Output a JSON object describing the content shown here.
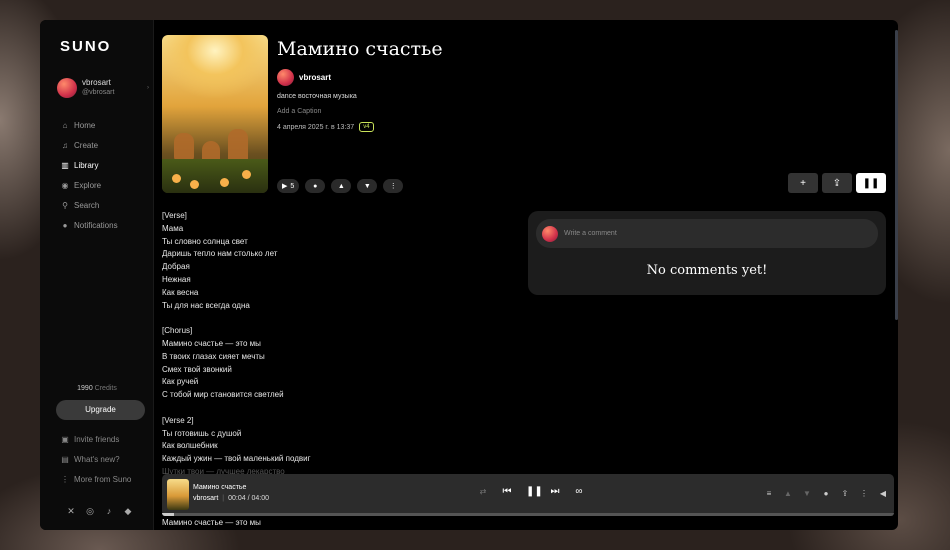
{
  "app": {
    "logo": "SUNO"
  },
  "user": {
    "name": "vbrosart",
    "handle": "@vbrosart"
  },
  "nav": [
    {
      "label": "Home",
      "icon": "home-icon",
      "active": false
    },
    {
      "label": "Create",
      "icon": "music-note-icon",
      "active": false
    },
    {
      "label": "Library",
      "icon": "library-icon",
      "active": true
    },
    {
      "label": "Explore",
      "icon": "compass-icon",
      "active": false
    },
    {
      "label": "Search",
      "icon": "search-icon",
      "active": false
    },
    {
      "label": "Notifications",
      "icon": "bell-icon",
      "active": false
    }
  ],
  "credits": {
    "amount": "1990",
    "label": "Credits"
  },
  "upgrade_label": "Upgrade",
  "bottom_nav": [
    {
      "label": "Invite friends",
      "icon": "gift-icon"
    },
    {
      "label": "What's new?",
      "icon": "news-icon"
    },
    {
      "label": "More from Suno",
      "icon": "more-vertical-icon"
    }
  ],
  "socials": [
    "x-icon",
    "instagram-icon",
    "tiktok-icon",
    "discord-icon"
  ],
  "song": {
    "title": "Мамино счастье",
    "artist": "vbrosart",
    "tags": "dance восточная музыка",
    "caption_placeholder": "Add a Caption",
    "date": "4 апреля 2025 г. в 13:37",
    "version": "v4",
    "play_count": "5"
  },
  "lyrics": [
    "[Verse]",
    "Мама",
    "Ты словно солнца свет",
    "Даришь тепло нам столько лет",
    "Добрая",
    "Нежная",
    "Как весна",
    "Ты для нас всегда одна",
    "",
    "[Chorus]",
    "Мамино счастье — это мы",
    "В твоих глазах сияет мечты",
    "Смех твой звонкий",
    "Как ручей",
    "С тобой мир становится светлей",
    "",
    "[Verse 2]",
    "Ты готовишь с душой",
    "Как волшебник",
    "Каждый ужин — твой маленький подвиг",
    "Шутки твои — лучшее лекарство"
  ],
  "lyrics_after_player": "Мамино счастье — это мы",
  "comments": {
    "placeholder": "Write a comment",
    "empty_text": "No comments yet!"
  },
  "player": {
    "title": "Мамино счастье",
    "artist": "vbrosart",
    "time": "00:04 / 04:00",
    "progress_fraction": 0.017
  }
}
